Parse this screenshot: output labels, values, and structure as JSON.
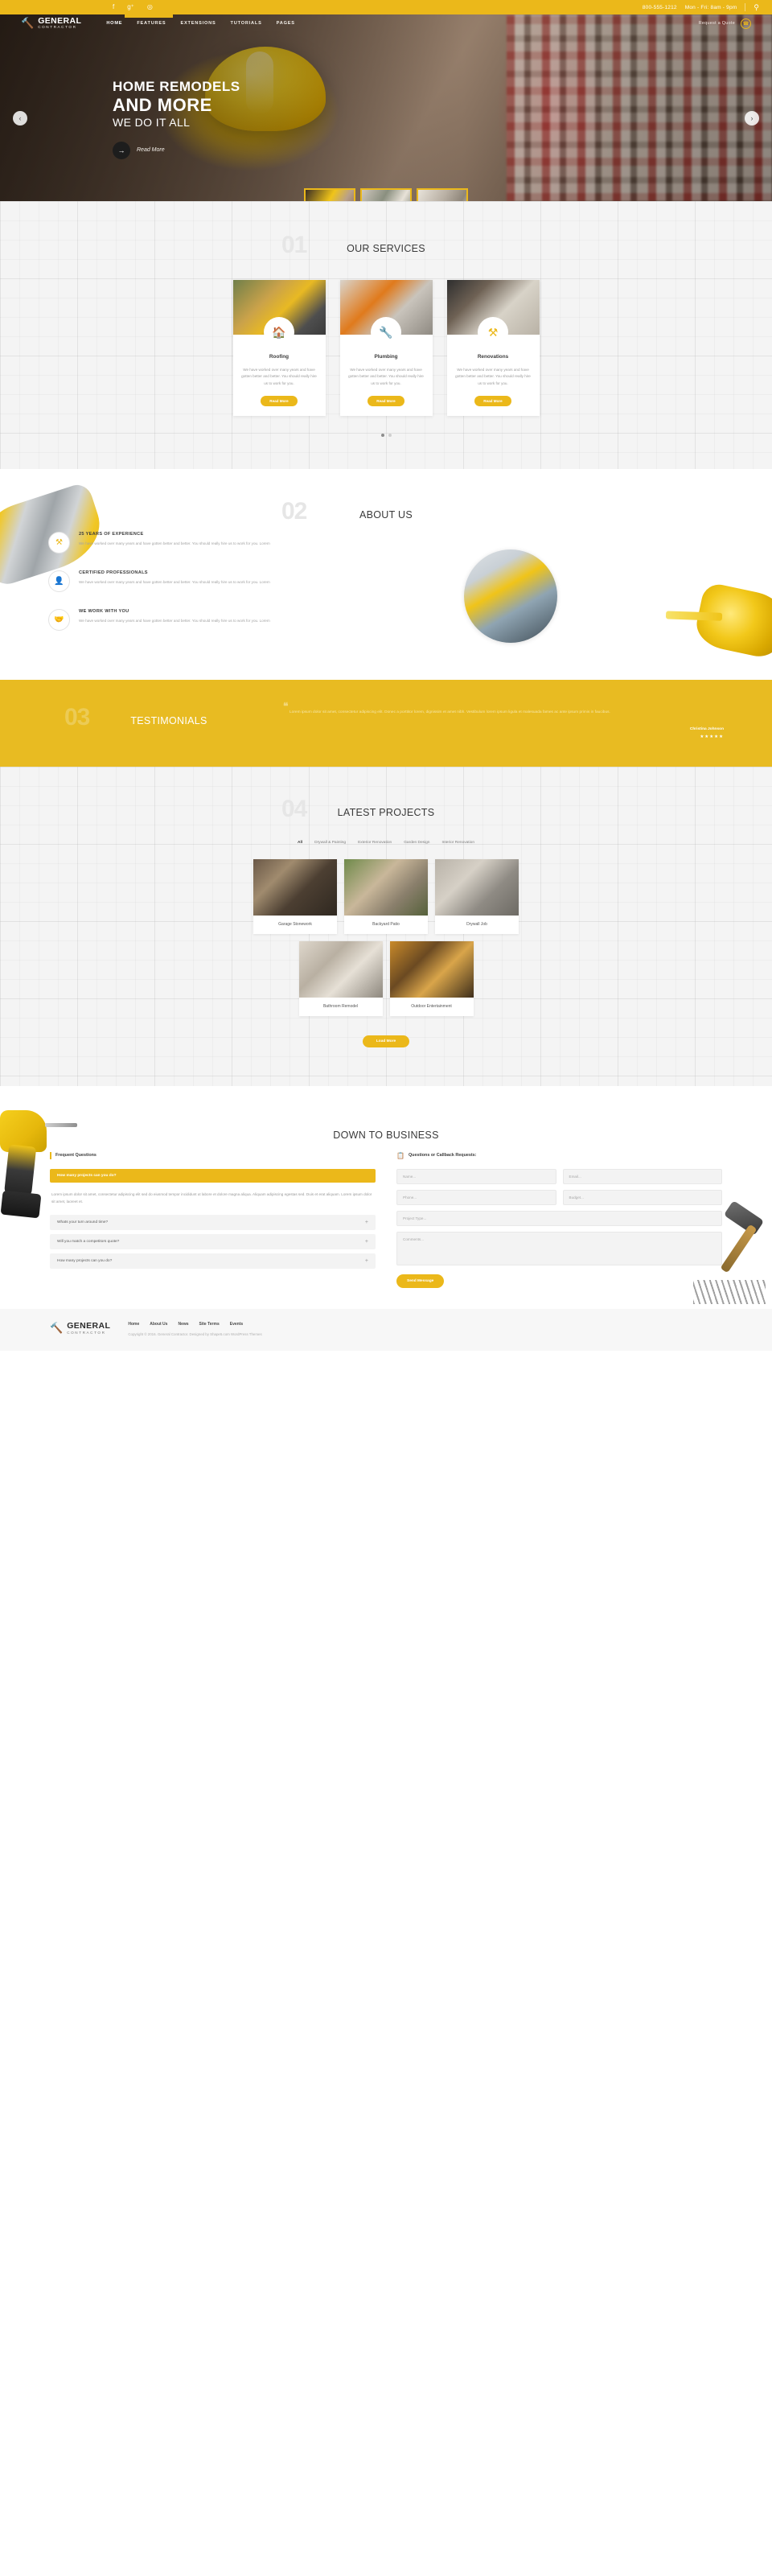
{
  "topbar": {
    "socials": [
      "facebook-icon",
      "google-plus-icon",
      "rss-icon"
    ],
    "phone": "800-555-1212",
    "hours": "Mon - Fri: 8am - 9pm",
    "search_icon": "search-icon"
  },
  "header": {
    "logo_icon": "hammer-icon",
    "brand_name": "GENERAL",
    "brand_sub": "CONTRACTOR",
    "nav": [
      {
        "label": "HOME",
        "active": true
      },
      {
        "label": "FEATURES",
        "active": false
      },
      {
        "label": "EXTENSIONS",
        "active": false
      },
      {
        "label": "TUTORIALS",
        "active": false
      },
      {
        "label": "PAGES",
        "active": false
      }
    ],
    "quote_label": "Request a Quote",
    "phone_icon": "phone-icon"
  },
  "hero": {
    "line1": "HOME REMODELS",
    "line2": "AND MORE",
    "line3": "WE DO IT ALL",
    "cta": "Read More",
    "cta_icon": "arrow-right-icon",
    "prev_icon": "chevron-left-icon",
    "next_icon": "chevron-right-icon",
    "thumbs": [
      "slide-thumb-1",
      "slide-thumb-2",
      "slide-thumb-3"
    ]
  },
  "services": {
    "number": "01",
    "title": "OUR SERVICES",
    "cards": [
      {
        "name": "Roofing",
        "icon": "home-icon",
        "desc": "We have worked over many years and have gotten better and better. You should really hire us to work for you.",
        "button": "Read More"
      },
      {
        "name": "Plumbing",
        "icon": "wrench-icon",
        "desc": "We have worked over many years and have gotten better and better. You should really hire us to work for you.",
        "button": "Read More"
      },
      {
        "name": "Renovations",
        "icon": "tools-icon",
        "desc": "We have worked over many years and have gotten better and better. You should really hire us to work for you.",
        "button": "Read More"
      }
    ],
    "dots": 2,
    "active_dot": 0
  },
  "about": {
    "number": "02",
    "title": "ABOUT US",
    "features": [
      {
        "icon": "tools-icon",
        "title": "25 YEARS OF EXPERIENCE",
        "desc": "We have worked over many years and have gotten better and better. You should really hire us to work for you. Lorem"
      },
      {
        "icon": "user-icon",
        "title": "CERTIFIED PROFESSIONALS",
        "desc": "We have worked over many years and have gotten better and better. You should really hire us to work for you. Lorem"
      },
      {
        "icon": "handshake-icon",
        "title": "WE WORK WITH YOU",
        "desc": "We have worked over many years and have gotten better and better. You should really hire us to work for you. Lorem"
      }
    ],
    "photo": "about-team-photo"
  },
  "testimonials": {
    "number": "03",
    "title": "TESTIMONIALS",
    "quote_icon": "quote-icon",
    "quote": "Lorem ipsum dolor sit amet, consectetur adipiscing elit. Donec a porttitor lorem, dignissim et amet nibh. Vestibulum lorem ipsum ligula et malesuada fames ac ante ipsum primis in faucibus.",
    "author": "Christina Johnson",
    "stars": "★★★★★"
  },
  "projects": {
    "number": "04",
    "title": "LATEST PROJECTS",
    "filters": [
      {
        "label": "All",
        "active": true
      },
      {
        "label": "Drywall & Painting",
        "active": false
      },
      {
        "label": "Exterior Renovation",
        "active": false
      },
      {
        "label": "Garden Design",
        "active": false
      },
      {
        "label": "Interior Renovation",
        "active": false
      }
    ],
    "items": [
      {
        "name": "Garage Stonework",
        "thumb": "p1"
      },
      {
        "name": "Backyard Patio",
        "thumb": "p2"
      },
      {
        "name": "Drywall Job",
        "thumb": "p3"
      },
      {
        "name": "Bathroom Remodel",
        "thumb": "p4"
      },
      {
        "name": "Outdoor Entertainment",
        "thumb": "p5"
      }
    ],
    "load_more": "Load More"
  },
  "business": {
    "title": "DOWN TO BUSINESS",
    "faq_heading": "Frequent Questions",
    "faq_icon": "bar-icon",
    "form_heading": "Questions or Callback Requests:",
    "form_icon": "clipboard-icon",
    "accordion_open": {
      "question": "How many projects can you do?",
      "answer": "Lorem ipsum dolor sit amet, consectetur adipiscing elit sed do eiusmod tempor incididunt ut labore et dolore magna aliqua. Aliquam adipiscing egestas sed. Duis et erat aliquam. Lorem ipsum dolor sit amet, laoreet et."
    },
    "accordion_closed": [
      {
        "question": "Whats your turn around time?",
        "icon": "plus-icon"
      },
      {
        "question": "Will you match a competitors quote?",
        "icon": "plus-icon"
      },
      {
        "question": "How many projects can you do?",
        "icon": "plus-icon"
      }
    ],
    "form_fields": [
      {
        "placeholder": "Name..."
      },
      {
        "placeholder": "Email..."
      },
      {
        "placeholder": "Phone..."
      },
      {
        "placeholder": "Budget..."
      },
      {
        "placeholder": "Project Type..."
      },
      {
        "placeholder": "Comments..."
      }
    ],
    "send_label": "Send Message"
  },
  "footer": {
    "logo_icon": "hammer-icon",
    "brand_name": "GENERAL",
    "brand_sub": "CONTRACTOR",
    "links": [
      "Home",
      "About Us",
      "News",
      "Site Terms",
      "Events"
    ],
    "copyright": "Copyright © 2016. General Contractor. Designed by Shape5.com WordPress Themes"
  }
}
